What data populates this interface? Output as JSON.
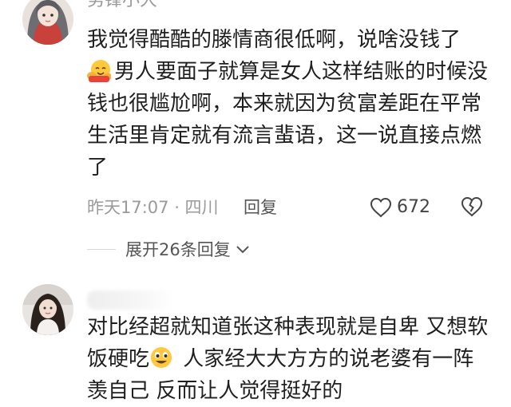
{
  "comments": [
    {
      "username": "努锋小大",
      "text_line1": "我觉得酷酷的滕情商很低啊，说啥没钱了",
      "text_emoji": "hugging-face-emoji",
      "text_rest": "男人要面子就算是女人这样结账的时候没钱也很尴尬啊，本来就因为贫富差距在平常生活里肯定就有流言蜚语，这一说直接点燃了",
      "time_location": "昨天17:07 · 四川",
      "reply_label": "回复",
      "like_count": "672",
      "expand_label": "展开26条回复"
    },
    {
      "username": "",
      "text_before_emoji": "对比经超就知道张这种表现就是自卑 又想软饭硬吃",
      "text_emoji": "grinning-face-emoji",
      "text_after_emoji": " 人家经大大方方的说老婆有一阵羡自己 反而让人觉得挺好的"
    }
  ],
  "colors": {
    "text": "#1f1f1f",
    "meta": "#9a9a9a",
    "secondary": "#555555"
  }
}
